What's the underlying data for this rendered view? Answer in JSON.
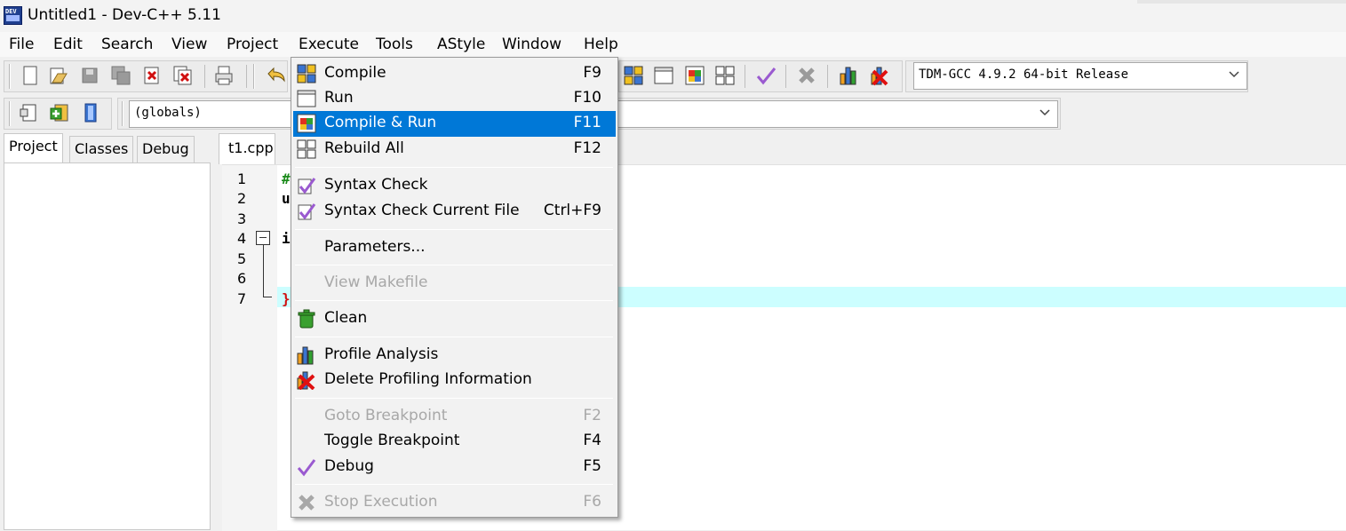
{
  "window": {
    "title": "Untitled1 - Dev-C++ 5.11",
    "icon_text": "DEV"
  },
  "menubar": [
    "File",
    "Edit",
    "Search",
    "View",
    "Project",
    "Execute",
    "Tools",
    "AStyle",
    "Window",
    "Help"
  ],
  "toolbar": {
    "compiler": "TDM-GCC 4.9.2 64-bit Release",
    "scope": "(globals)"
  },
  "left_panel": {
    "tabs": [
      "Project",
      "Classes",
      "Debug"
    ],
    "active_tab": "Project"
  },
  "editor": {
    "file_tab": "t1.cpp",
    "line_numbers": [
      "1",
      "2",
      "3",
      "4",
      "5",
      "6",
      "7"
    ],
    "visible_chars": [
      "#",
      "u",
      "i",
      "}"
    ]
  },
  "execute_menu": {
    "items": [
      {
        "label": "Compile",
        "shortcut": "F9",
        "icon": "compile-icon"
      },
      {
        "label": "Run",
        "shortcut": "F10",
        "icon": "run-icon"
      },
      {
        "label": "Compile & Run",
        "shortcut": "F11",
        "icon": "compile-run-icon",
        "highlighted": true
      },
      {
        "label": "Rebuild All",
        "shortcut": "F12",
        "icon": "rebuild-all-icon"
      },
      {
        "label": "Syntax Check",
        "shortcut": "",
        "icon": "syntax-check-icon"
      },
      {
        "label": "Syntax Check Current File",
        "shortcut": "Ctrl+F9",
        "icon": "syntax-check-file-icon"
      },
      {
        "label": "Parameters...",
        "shortcut": ""
      },
      {
        "label": "View Makefile",
        "shortcut": "",
        "disabled": true
      },
      {
        "label": "Clean",
        "shortcut": "",
        "icon": "trash-icon"
      },
      {
        "label": "Profile Analysis",
        "shortcut": "",
        "icon": "bar-chart-icon"
      },
      {
        "label": "Delete Profiling Information",
        "shortcut": "",
        "icon": "delete-profile-icon"
      },
      {
        "label": "Goto Breakpoint",
        "shortcut": "F2",
        "disabled": true
      },
      {
        "label": "Toggle Breakpoint",
        "shortcut": "F4"
      },
      {
        "label": "Debug",
        "shortcut": "F5",
        "icon": "checkmark-icon"
      },
      {
        "label": "Stop Execution",
        "shortcut": "F6",
        "icon": "stop-x-icon",
        "disabled": true
      }
    ]
  },
  "colors": {
    "highlight": "#0078d7",
    "active_line": "#ccfeff",
    "disabled_text": "#a8a8a8"
  }
}
